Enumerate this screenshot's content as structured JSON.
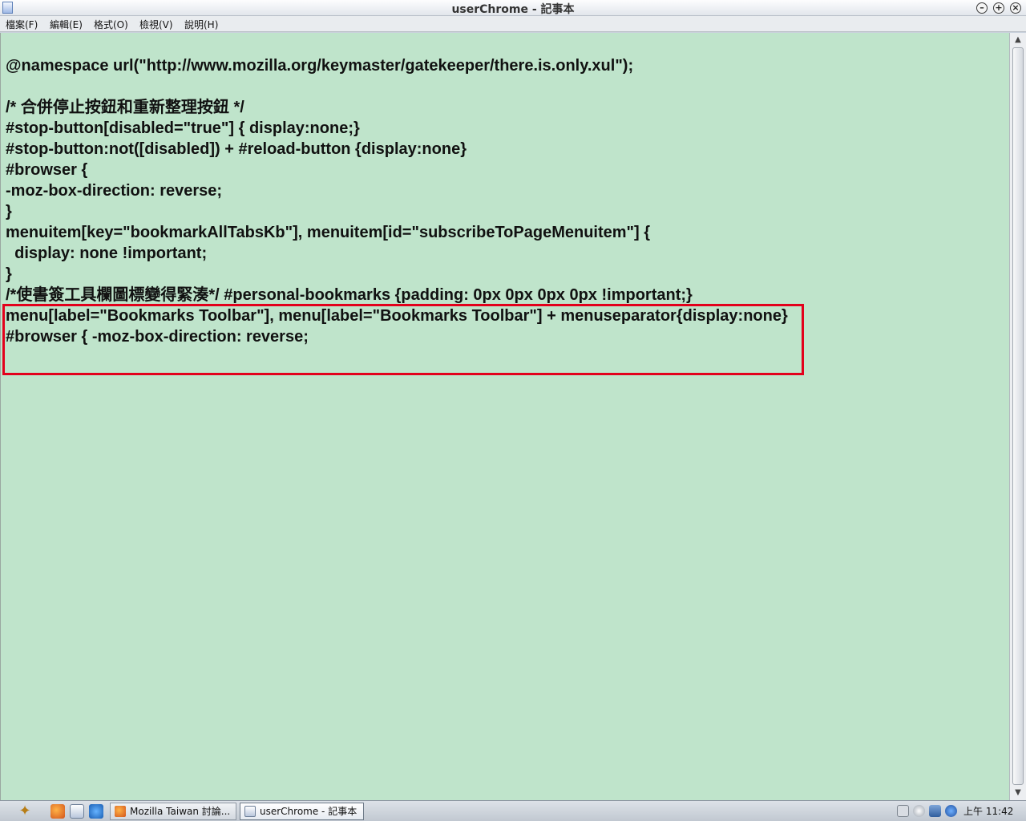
{
  "window": {
    "title": "userChrome - 記事本",
    "buttons": {
      "minimize": "–",
      "maximize": "+",
      "close": "×"
    }
  },
  "menu": [
    {
      "label": "檔案(F)"
    },
    {
      "label": "編輯(E)"
    },
    {
      "label": "格式(O)"
    },
    {
      "label": "檢視(V)"
    },
    {
      "label": "說明(H)"
    }
  ],
  "editor": {
    "background_color": "#bfe4cb",
    "highlight_color": "#e3001b",
    "lines": [
      "",
      "@namespace url(\"http://www.mozilla.org/keymaster/gatekeeper/there.is.only.xul\");",
      "",
      "/* 合併停止按鈕和重新整理按鈕 */",
      "#stop-button[disabled=\"true\"] { display:none;}",
      "#stop-button:not([disabled]) + #reload-button {display:none}",
      "#browser {",
      "-moz-box-direction: reverse;",
      "}",
      "menuitem[key=\"bookmarkAllTabsKb\"], menuitem[id=\"subscribeToPageMenuitem\"] {",
      "  display: none !important;",
      "}",
      "/*使書簽工具欄圖標變得緊湊*/ #personal-bookmarks {padding: 0px 0px 0px 0px !important;}",
      "menu[label=\"Bookmarks Toolbar\"], menu[label=\"Bookmarks Toolbar\"] + menuseparator{display:none}",
      "#browser { -moz-box-direction: reverse;"
    ]
  },
  "scrollbar": {
    "up_arrow": "▲",
    "down_arrow": "▼"
  },
  "taskbar": {
    "start_icon": "bird-emblem-icon",
    "quick_launch": [
      "firefox-icon",
      "notepad-icon",
      "ie-icon"
    ],
    "tasks": [
      {
        "label": "Mozilla Taiwan 討論...",
        "icon": "firefox-icon",
        "active": false
      },
      {
        "label": "userChrome - 記事本",
        "icon": "notepad-icon",
        "active": true
      }
    ],
    "tray_icons": [
      "keyboard-icon",
      "network-icon",
      "display-icon",
      "update-icon"
    ],
    "clock": "上午 11:42"
  }
}
